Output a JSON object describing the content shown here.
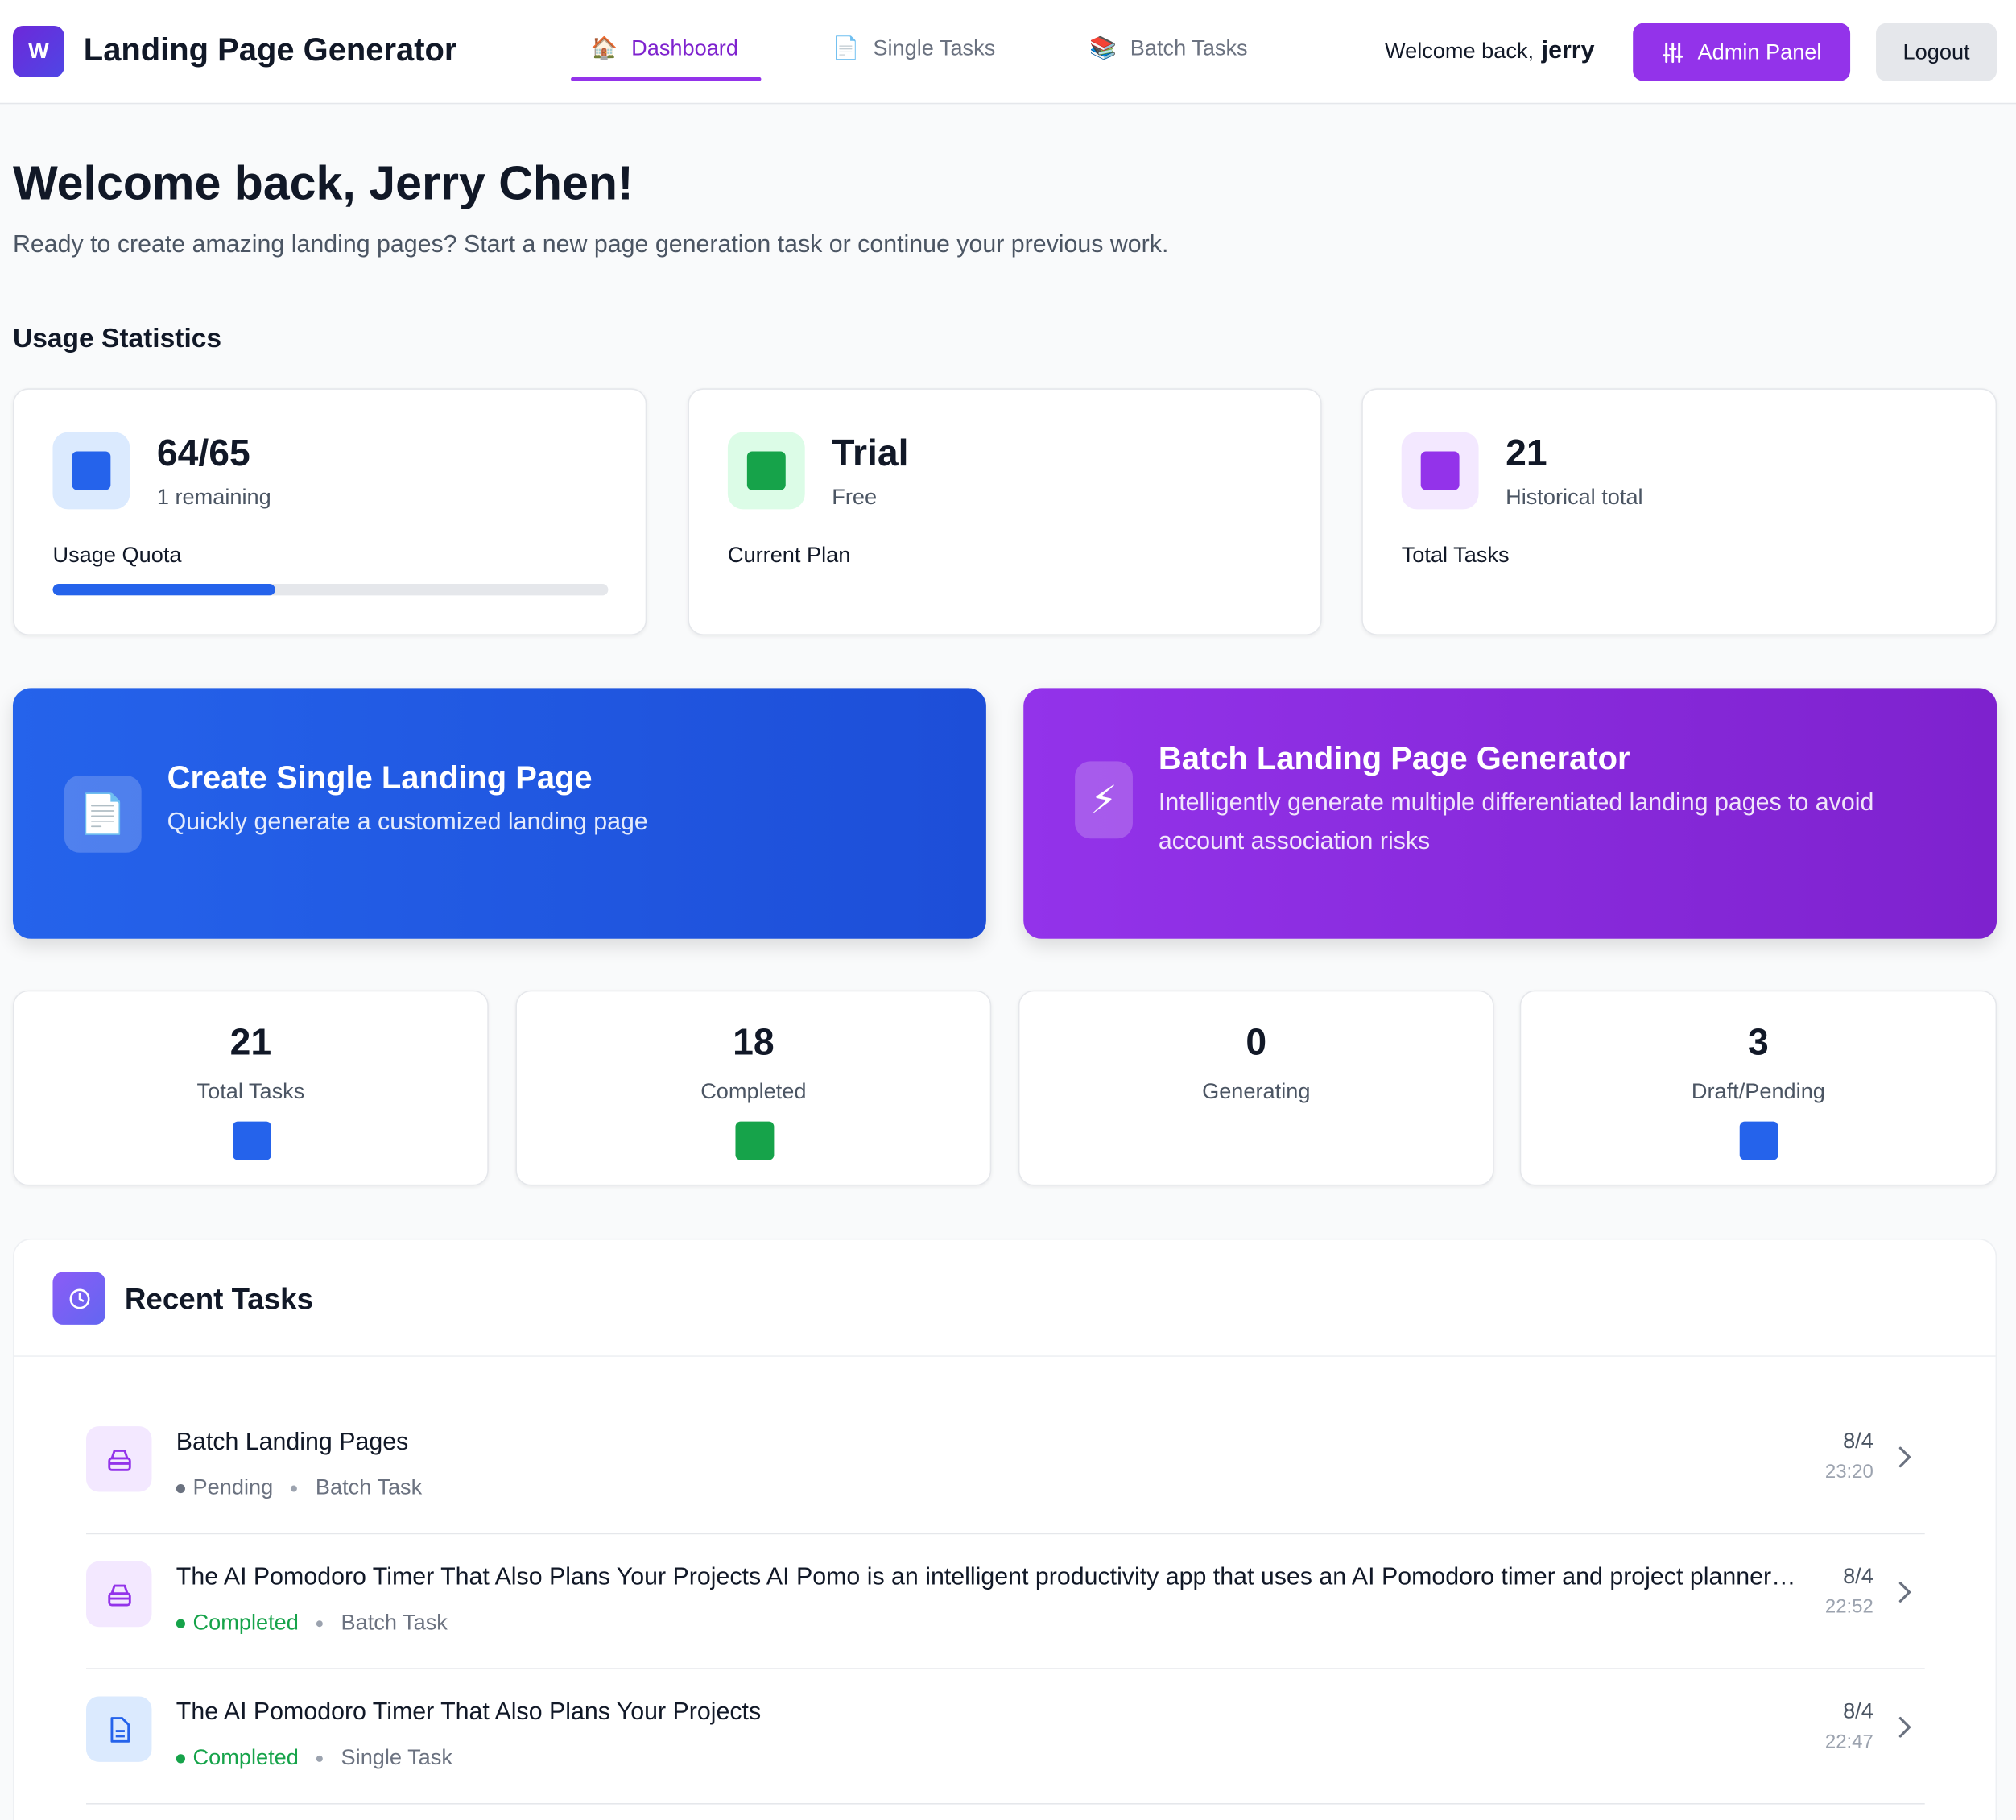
{
  "header": {
    "logo_letter": "W",
    "app_title": "Landing Page Generator",
    "nav": [
      {
        "label": "Dashboard",
        "icon": "house-icon",
        "glyph": "🏠",
        "active": true
      },
      {
        "label": "Single Tasks",
        "icon": "document-icon",
        "glyph": "📄",
        "active": false
      },
      {
        "label": "Batch Tasks",
        "icon": "books-icon",
        "glyph": "📚",
        "active": false
      }
    ],
    "welcome_prefix": "Welcome back,",
    "username": "jerry",
    "admin_label": "Admin Panel",
    "logout_label": "Logout"
  },
  "page": {
    "title": "Welcome back, Jerry Chen!",
    "subtitle": "Ready to create amazing landing pages? Start a new page generation task or continue your previous work.",
    "section_title": "Usage Statistics"
  },
  "usage": {
    "quota": {
      "value": "64/65",
      "sub": "1 remaining",
      "label": "Usage Quota",
      "progress_fraction": 0.4
    },
    "plan": {
      "value": "Trial",
      "sub": "Free",
      "label": "Current Plan"
    },
    "total": {
      "value": "21",
      "sub": "Historical total",
      "label": "Total Tasks"
    }
  },
  "actions": {
    "single": {
      "title": "Create Single Landing Page",
      "desc": "Quickly generate a customized landing page",
      "icon": "📄"
    },
    "batch": {
      "title": "Batch Landing Page Generator",
      "desc": "Intelligently generate multiple differentiated landing pages to avoid account association risks",
      "icon": "⚡"
    }
  },
  "counts": [
    {
      "value": "21",
      "label": "Total Tasks",
      "color": "#2563eb"
    },
    {
      "value": "18",
      "label": "Completed",
      "color": "#16a34a"
    },
    {
      "value": "0",
      "label": "Generating",
      "color": ""
    },
    {
      "value": "3",
      "label": "Draft/Pending",
      "color": "#2563eb"
    }
  ],
  "recent": {
    "title": "Recent Tasks",
    "tasks": [
      {
        "title": "Batch Landing Pages",
        "status": "Pending",
        "status_color": "#6b7280",
        "type": "Batch Task",
        "date": "8/4",
        "time": "23:20",
        "icon": "stack-icon"
      },
      {
        "title": "The AI Pomodoro Timer That Also Plans Your Projects AI Pomo is an intelligent productivity app that uses an AI Pomodoro timer and project planner to help you focus and plan your work",
        "status": "Completed",
        "status_color": "#16a34a",
        "type": "Batch Task",
        "date": "8/4",
        "time": "22:52",
        "icon": "stack-icon"
      },
      {
        "title": "The AI Pomodoro Timer That Also Plans Your Projects",
        "status": "Completed",
        "status_color": "#16a34a",
        "type": "Single Task",
        "date": "8/4",
        "time": "22:47",
        "icon": "file-icon"
      }
    ]
  },
  "colors": {
    "accent": "#9333ea",
    "primary": "#2563eb",
    "success": "#16a34a"
  }
}
